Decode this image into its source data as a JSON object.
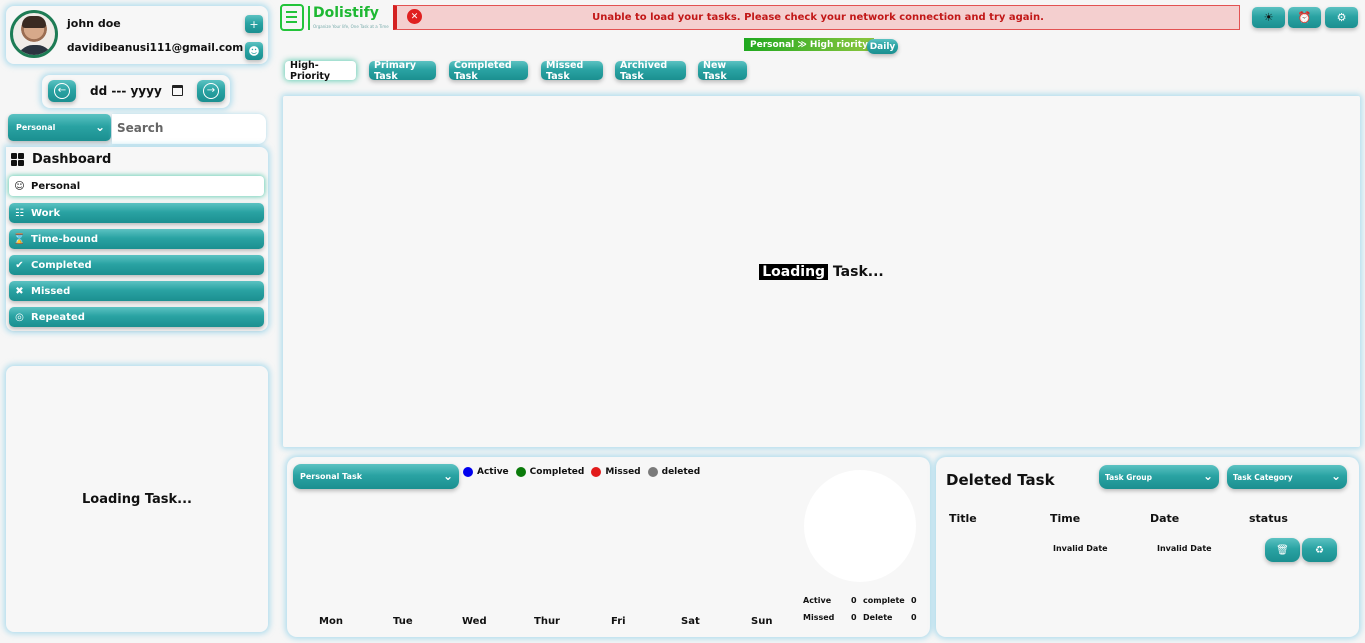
{
  "user": {
    "name": "john doe",
    "email": "davidibeanusi111@gmail.com"
  },
  "date_input": {
    "value": "dd --- yyyy"
  },
  "search": {
    "group_selected": "Personal",
    "placeholder": "Search"
  },
  "nav": {
    "title": "Dashboard",
    "items": [
      {
        "label": "Personal",
        "icon": "user-circle-icon",
        "active": true
      },
      {
        "label": "Work",
        "icon": "org-chart-icon",
        "active": false
      },
      {
        "label": "Time-bound",
        "icon": "hourglass-icon",
        "active": false
      },
      {
        "label": "Completed",
        "icon": "check-circle-icon",
        "active": false
      },
      {
        "label": "Missed",
        "icon": "x-circle-icon",
        "active": false
      },
      {
        "label": "Repeated",
        "icon": "target-icon",
        "active": false
      }
    ]
  },
  "sidebar_loading": "Loading Task...",
  "header": {
    "logo_name": "Dolistify",
    "logo_tagline": "Organize Your life, One Task at a Time",
    "error_message": "Unable to load your tasks. Please check your network connection and try again.",
    "breadcrumb": "Personal ≫ High riority",
    "daily_tag": "Daily"
  },
  "tabs": [
    {
      "label": "High-Priority",
      "active": true
    },
    {
      "label": "Primary Task",
      "active": false
    },
    {
      "label": "Completed Task",
      "active": false
    },
    {
      "label": "Missed Task",
      "active": false
    },
    {
      "label": "Archived Task",
      "active": false
    },
    {
      "label": "New Task",
      "active": false
    }
  ],
  "main": {
    "loading_word": "Loading",
    "loading_rest": " Task..."
  },
  "chart_panel": {
    "select_label": "Personal Task",
    "legend": [
      {
        "label": "Active",
        "color": "#0000ee"
      },
      {
        "label": "Completed",
        "color": "#0a7a0a"
      },
      {
        "label": "Missed",
        "color": "#e21b1b"
      },
      {
        "label": "deleted",
        "color": "#7a7a7a"
      }
    ],
    "days": [
      "Mon",
      "Tue",
      "Wed",
      "Thur",
      "Fri",
      "Sat",
      "Sun"
    ],
    "stats": {
      "active_label": "Active",
      "active_value": "0",
      "complete_label": "complete",
      "complete_value": "0",
      "missed_label": "Missed",
      "missed_value": "0",
      "delete_label": "Delete",
      "delete_value": "0"
    }
  },
  "deleted_panel": {
    "title": "Deleted Task",
    "group_select": "Task Group",
    "category_select": "Task Category",
    "columns": [
      "Title",
      "Time",
      "Date",
      "status"
    ],
    "row": {
      "time": "Invalid Date",
      "date": "Invalid Date"
    }
  },
  "colors": {
    "accent": "#2aa3a3",
    "error_bg": "#f4cfcf",
    "error_text": "#c21818",
    "brand_green": "#1eb833"
  }
}
